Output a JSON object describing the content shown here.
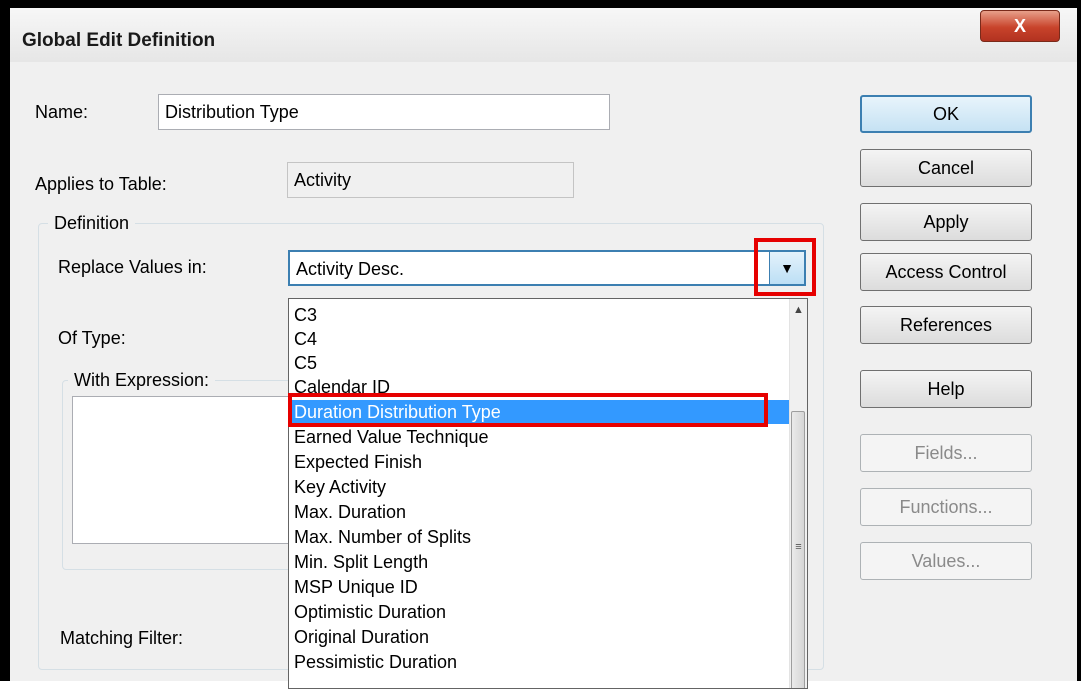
{
  "window": {
    "title": "Global Edit Definition",
    "close_label": "X"
  },
  "name": {
    "label": "Name:",
    "value": "Distribution Type"
  },
  "applies_to": {
    "label": "Applies to Table:",
    "value": "Activity"
  },
  "definition": {
    "group_label": "Definition",
    "replace_label": "Replace Values in:",
    "replace_value": "Activity Desc.",
    "of_type_label": "Of Type:",
    "expression_group_label": "With Expression:",
    "matching_filter_label": "Matching Filter:"
  },
  "dropdown": {
    "items": [
      "C3",
      "C4",
      "C5",
      "Calendar ID",
      "Duration Distribution Type",
      "Earned Value Technique",
      "Expected Finish",
      "Key Activity",
      "Max. Duration",
      "Max. Number of Splits",
      "Min. Split Length",
      "MSP Unique ID",
      "Optimistic Duration",
      "Original Duration",
      "Pessimistic Duration"
    ],
    "selected": "Duration Distribution Type"
  },
  "buttons": {
    "ok": "OK",
    "cancel": "Cancel",
    "apply": "Apply",
    "access_control": "Access Control",
    "references": "References",
    "help": "Help",
    "fields": "Fields...",
    "functions": "Functions...",
    "values": "Values..."
  },
  "icons": {
    "dropdown_arrow": "chevron-down-icon",
    "scroll_up": "scroll-up-icon",
    "thumb_grip": "grip-icon"
  },
  "colors": {
    "highlight": "#e60000",
    "selection": "#3399ff"
  }
}
